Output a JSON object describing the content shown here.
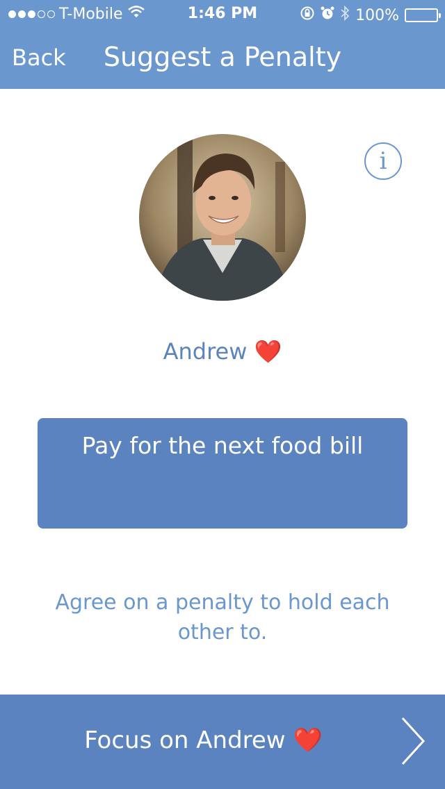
{
  "status_bar": {
    "carrier": "T-Mobile",
    "time": "1:46 PM",
    "battery": "100%",
    "battery_level": 1.0,
    "signal_bars_filled": 3,
    "signal_bars_total": 5,
    "icons": [
      "wifi-icon",
      "rotation-lock-icon",
      "alarm-icon",
      "bluetooth-icon",
      "battery-icon"
    ]
  },
  "nav": {
    "back_label": "Back",
    "title": "Suggest a Penalty"
  },
  "info_icon": {
    "symbol": "i"
  },
  "partner": {
    "name": "Andrew",
    "heart": "❤️"
  },
  "penalty": {
    "value": "Pay for the next food bill"
  },
  "helper": {
    "text": "Agree on a penalty to hold each other to."
  },
  "bottom": {
    "label": "Focus on Andrew",
    "heart": "❤️"
  },
  "colors": {
    "header": "#6a97cd",
    "accent": "#5b83c0",
    "heart": "#d0131b",
    "background": "#ffffff"
  }
}
